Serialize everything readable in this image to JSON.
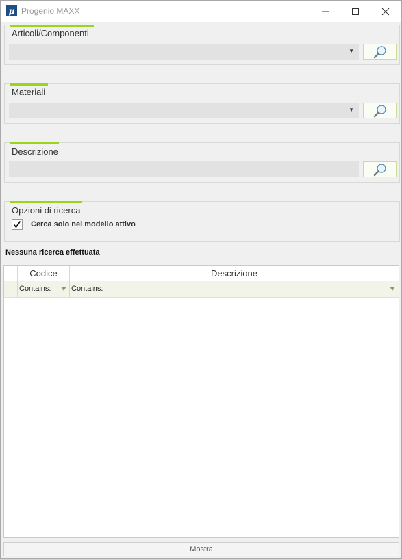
{
  "window": {
    "title": "Progenio MAXX",
    "app_icon_glyph": "µ",
    "icons": {
      "minimize": "minimize-icon",
      "maximize": "maximize-icon",
      "close": "close-icon"
    }
  },
  "groups": {
    "articoli": {
      "label": "Articoli/Componenti",
      "value": ""
    },
    "materiali": {
      "label": "Materiali",
      "value": ""
    },
    "descrizione": {
      "label": "Descrizione",
      "value": ""
    },
    "opzioni": {
      "label": "Opzioni di ricerca"
    }
  },
  "options": {
    "active_model_only": {
      "label": "Cerca solo nel modello attivo",
      "checked": true
    }
  },
  "status": {
    "text": "Nessuna ricerca effettuata"
  },
  "grid": {
    "columns": [
      "Codice",
      "Descrizione"
    ],
    "filter_labels": [
      "Contains:",
      "Contains:"
    ],
    "rows": []
  },
  "footer": {
    "button_label": "Mostra"
  },
  "colors": {
    "accent": "#9dd417",
    "background": "#f0f0f0",
    "app_icon": "#1f4e87",
    "filter_row": "#f2f4ea"
  }
}
